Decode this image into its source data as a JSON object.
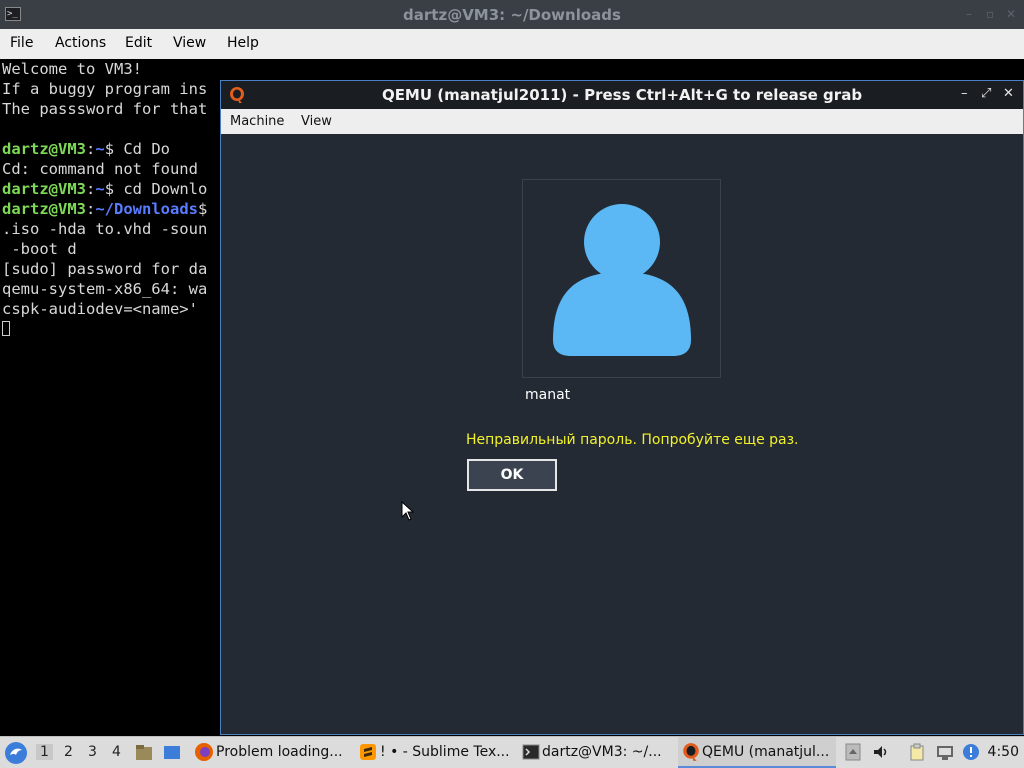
{
  "terminal": {
    "title": "dartz@VM3: ~/Downloads",
    "window_buttons": [
      "–",
      "▫",
      "✕"
    ],
    "menu": [
      "File",
      "Actions",
      "Edit",
      "View",
      "Help"
    ],
    "lines": [
      "Welcome to VM3!",
      "If a buggy program ins",
      "The passsword for that",
      "",
      "",
      "Cd: command not found",
      "",
      "",
      ".iso -hda to.vhd -soun",
      " -boot d",
      "[sudo] password for da",
      "qemu-system-x86_64: wa",
      "cspk-audiodev=<name>'"
    ],
    "prompt1": {
      "user": "dartz@VM3",
      "sep": ":",
      "path": "~",
      "cmd": "$ Cd Do"
    },
    "prompt2": {
      "user": "dartz@VM3",
      "sep": ":",
      "path": "~",
      "cmd": "$ cd Downlo"
    },
    "prompt3": {
      "user": "dartz@VM3",
      "sep": ":",
      "path": "~/Downloads",
      "cmd": "$"
    }
  },
  "qemu": {
    "title": "QEMU (manatjul2011) - Press Ctrl+Alt+G to release grab",
    "menu": [
      "Machine",
      "View"
    ],
    "window_buttons": [
      "–",
      "⤢",
      "✕"
    ],
    "login": {
      "username": "manat",
      "error": "Неправильный пароль. Попробуйте еще раз.",
      "ok_label": "OK"
    }
  },
  "taskbar": {
    "workspaces": [
      "1",
      "2",
      "3",
      "4"
    ],
    "tasks": [
      {
        "label": "Problem loading..."
      },
      {
        "label": "! • - Sublime Tex..."
      },
      {
        "label": "dartz@VM3: ~/..."
      },
      {
        "label": "QEMU (manatjul..."
      }
    ],
    "clock": "4:50"
  },
  "colors": {
    "prompt_user": "#7ed957",
    "prompt_path": "#5a7cff",
    "error_text": "#f2f22a",
    "avatar": "#5bb8f5",
    "qemu_bg": "#232a34"
  }
}
